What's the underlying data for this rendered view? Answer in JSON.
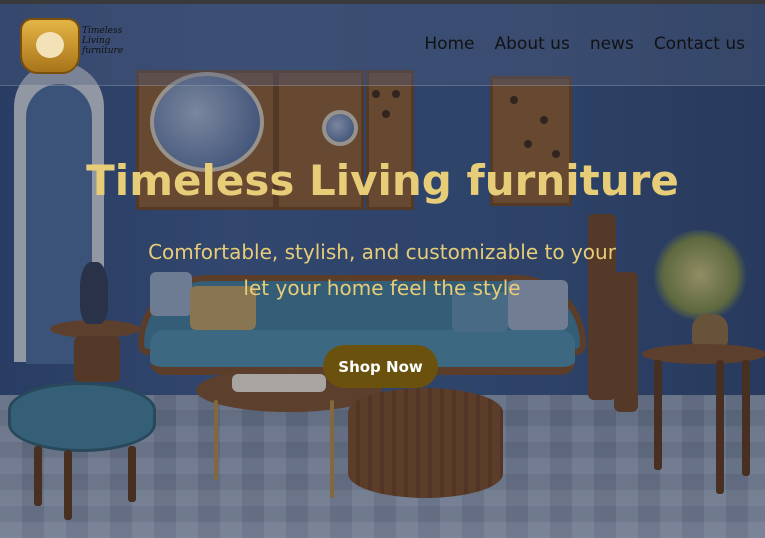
{
  "brand": {
    "logo_lines": [
      "Timeless",
      "Living",
      "furniture"
    ]
  },
  "nav": {
    "items": [
      "Home",
      "About us",
      "news",
      "Contact us"
    ]
  },
  "hero": {
    "title": "Timeless Living furniture",
    "subtitle_line1": "Comfortable, stylish, and customizable to your",
    "subtitle_line2": "let your home feel the style",
    "cta_label": "Shop Now"
  },
  "colors": {
    "accent_text": "#e8cd78",
    "cta_background": "#6a520e",
    "nav_text": "#121212"
  },
  "icons": {
    "logo": "armchair-logo-icon"
  }
}
